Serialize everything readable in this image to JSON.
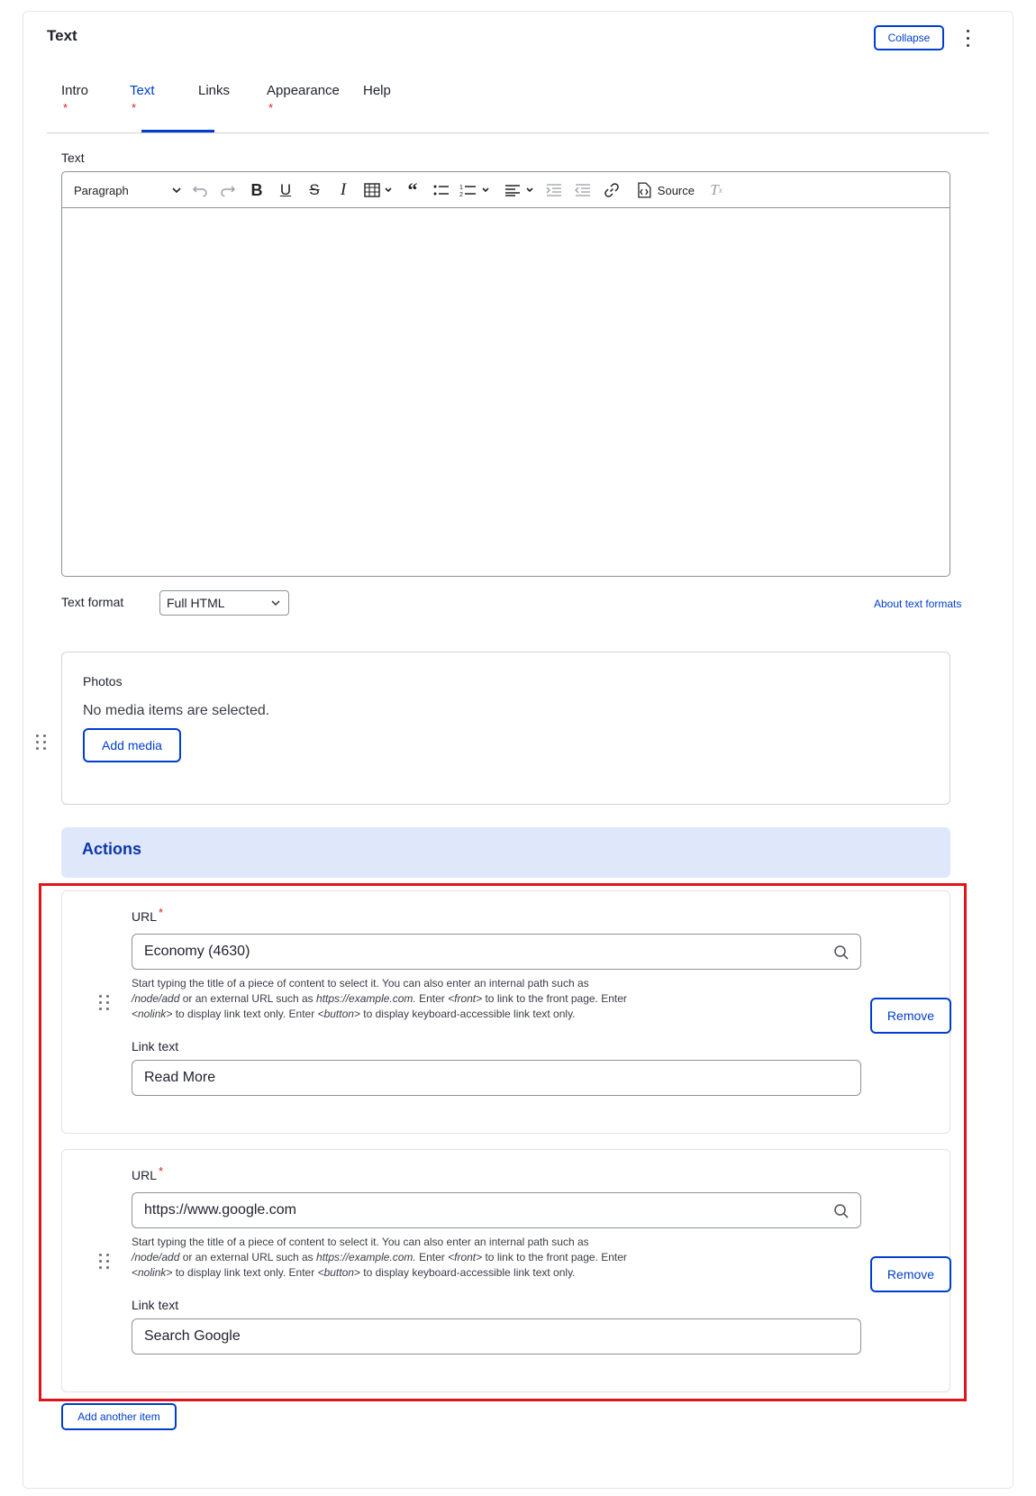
{
  "card": {
    "title": "Text",
    "collapse_label": "Collapse",
    "menu_icon": "kebab-icon"
  },
  "tabs": [
    {
      "label": "Intro",
      "required": "*"
    },
    {
      "label": "Text",
      "required": "*"
    },
    {
      "label": "Links",
      "required": ""
    },
    {
      "label": "Appearance",
      "required": "*"
    },
    {
      "label": "Help",
      "required": ""
    }
  ],
  "active_tab": "Text",
  "editor": {
    "label": "Text",
    "paragraph_label": "Paragraph",
    "source_label": "Source",
    "body": ""
  },
  "text_format": {
    "label": "Text format",
    "selected": "Full HTML",
    "about_link": "About text formats"
  },
  "photos": {
    "title": "Photos",
    "empty_text": "No media items are selected.",
    "add_button": "Add media"
  },
  "actions": {
    "title": "Actions",
    "items": [
      {
        "url_label": "URL",
        "required": "*",
        "url_value": "Economy (4630)",
        "desc_1": "Start typing the title of a piece of content to select it. You can also enter an internal path such as",
        "desc_node_add": "/node/add",
        "desc_2": " or an external URL such as ",
        "desc_example": "https://example.com.",
        "desc_3": " Enter ",
        "desc_front": "<front>",
        "desc_4": " to link to the front page. Enter",
        "desc_nolink": "<nolink>",
        "desc_5": " to display link text only. Enter ",
        "desc_button": "<button>",
        "desc_6": " to display keyboard-accessible link text only.",
        "link_text_label": "Link text",
        "link_text_value": "Read More",
        "remove_label": "Remove"
      },
      {
        "url_label": "URL",
        "required": "*",
        "url_value": "https://www.google.com",
        "desc_1": "Start typing the title of a piece of content to select it. You can also enter an internal path such as",
        "desc_node_add": "/node/add",
        "desc_2": " or an external URL such as ",
        "desc_example": "https://example.com.",
        "desc_3": " Enter ",
        "desc_front": "<front>",
        "desc_4": " to link to the front page. Enter",
        "desc_nolink": "<nolink>",
        "desc_5": " to display link text only. Enter ",
        "desc_button": "<button>",
        "desc_6": " to display keyboard-accessible link text only.",
        "link_text_label": "Link text",
        "link_text_value": "Search Google",
        "remove_label": "Remove"
      }
    ],
    "add_another": "Add another item"
  },
  "colors": {
    "accent": "#003ecc",
    "required": "#d72222",
    "actions_bg": "#dfe8fb",
    "highlight_frame": "#e0141a"
  }
}
